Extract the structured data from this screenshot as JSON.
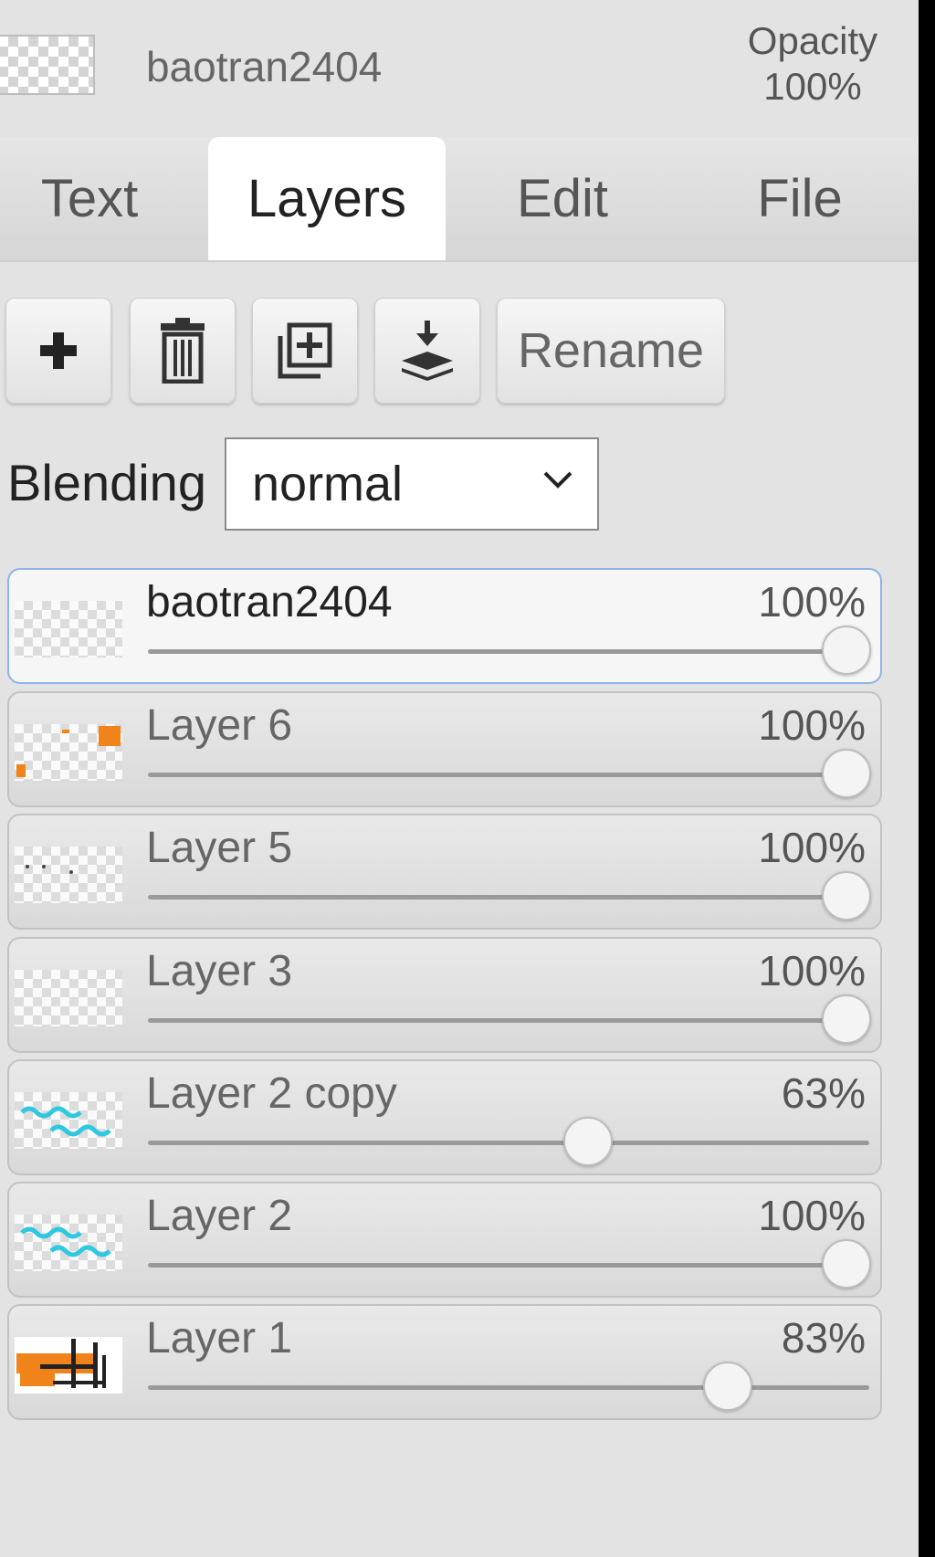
{
  "header": {
    "layer_name": "baotran2404",
    "opacity_label": "Opacity",
    "opacity_value": "100%"
  },
  "tabs": [
    {
      "label": "Text",
      "active": false
    },
    {
      "label": "Layers",
      "active": true
    },
    {
      "label": "Edit",
      "active": false
    },
    {
      "label": "File",
      "active": false
    }
  ],
  "toolbar": {
    "icons": [
      "plus-icon",
      "trash-icon",
      "duplicate-icon",
      "merge-down-icon"
    ],
    "rename_label": "Rename"
  },
  "blending": {
    "label": "Blending",
    "value": "normal"
  },
  "layers": [
    {
      "name": "baotran2404",
      "opacity_label": "100%",
      "opacity": 1.0,
      "selected": true
    },
    {
      "name": "Layer 6",
      "opacity_label": "100%",
      "opacity": 1.0,
      "selected": false
    },
    {
      "name": "Layer 5",
      "opacity_label": "100%",
      "opacity": 1.0,
      "selected": false
    },
    {
      "name": "Layer 3",
      "opacity_label": "100%",
      "opacity": 1.0,
      "selected": false
    },
    {
      "name": "Layer 2 copy",
      "opacity_label": "63%",
      "opacity": 0.63,
      "selected": false
    },
    {
      "name": "Layer 2",
      "opacity_label": "100%",
      "opacity": 1.0,
      "selected": false
    },
    {
      "name": "Layer 1",
      "opacity_label": "83%",
      "opacity": 0.83,
      "selected": false
    }
  ],
  "colors": {
    "selected_border": "#8fb2e6",
    "thumb_orange": "#f0841a",
    "thumb_cyan": "#2ec8e0"
  }
}
